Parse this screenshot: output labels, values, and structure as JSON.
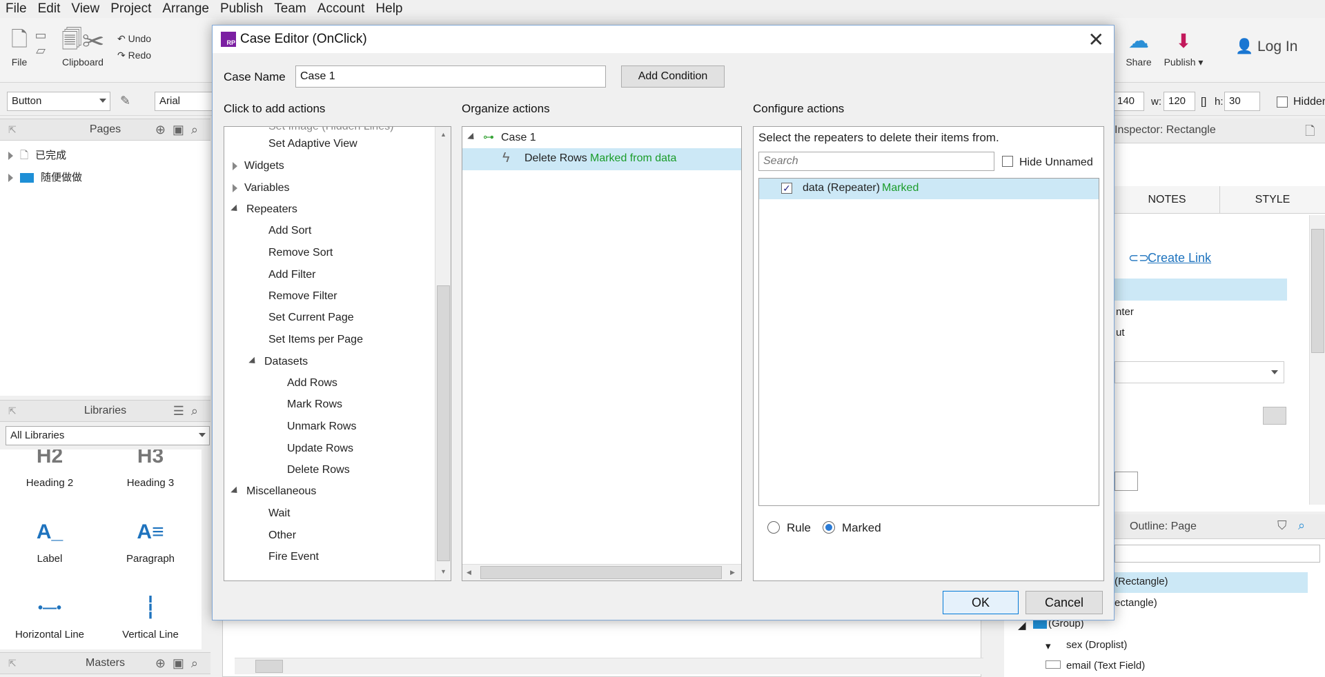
{
  "menu": [
    "File",
    "Edit",
    "View",
    "Project",
    "Arrange",
    "Publish",
    "Team",
    "Account",
    "Help"
  ],
  "toolbar": {
    "file_label": "File",
    "clipboard_label": "Clipboard",
    "undo_label": "Undo",
    "redo_label": "Redo",
    "share_label": "Share",
    "publish_label": "Publish ▾",
    "login_label": "Log In"
  },
  "format_bar": {
    "widget_type": "Button",
    "font": "Arial",
    "x_value": "140",
    "w_label": "w:",
    "w_value": "120",
    "h_label": "h:",
    "h_value": "30",
    "hidden_label": "Hidden"
  },
  "pages_panel": {
    "title": "Pages",
    "items": [
      "已完成",
      "随便做做"
    ]
  },
  "libraries_panel": {
    "title": "Libraries",
    "selected_library": "All Libraries",
    "items": [
      {
        "label": "Heading 2",
        "glyph": "H2"
      },
      {
        "label": "Heading 3",
        "glyph": "H3"
      },
      {
        "label": "Label",
        "glyph": "A_"
      },
      {
        "label": "Paragraph",
        "glyph": "A≡"
      },
      {
        "label": "Horizontal Line",
        "glyph": "•—•"
      },
      {
        "label": "Vertical Line",
        "glyph": "┆"
      }
    ]
  },
  "masters_panel": {
    "title": "Masters"
  },
  "inspector": {
    "title": "Inspector: Rectangle",
    "tab_notes": "NOTES",
    "tab_style": "STYLE",
    "create_link": "Create Link",
    "partial_1": "nter",
    "partial_2": "ut"
  },
  "outline": {
    "title": "Outline: Page",
    "items": [
      "(Rectangle)",
      "ectangle)",
      "(Group)",
      "sex (Droplist)",
      "email (Text Field)"
    ]
  },
  "dialog": {
    "title": "Case Editor (OnClick)",
    "case_name_label": "Case Name",
    "case_name_value": "Case 1",
    "add_condition_label": "Add Condition",
    "add_actions_title": "Click to add actions",
    "organize_title": "Organize actions",
    "configure_title": "Configure actions",
    "actions": [
      {
        "label": "Set Adaptive View",
        "level": 2,
        "kind": "leaf"
      },
      {
        "label": "Widgets",
        "level": 1,
        "kind": "collapsed"
      },
      {
        "label": "Variables",
        "level": 1,
        "kind": "collapsed"
      },
      {
        "label": "Repeaters",
        "level": 1,
        "kind": "expanded"
      },
      {
        "label": "Add Sort",
        "level": 2,
        "kind": "leaf"
      },
      {
        "label": "Remove Sort",
        "level": 2,
        "kind": "leaf"
      },
      {
        "label": "Add Filter",
        "level": 2,
        "kind": "leaf"
      },
      {
        "label": "Remove Filter",
        "level": 2,
        "kind": "leaf"
      },
      {
        "label": "Set Current Page",
        "level": 2,
        "kind": "leaf"
      },
      {
        "label": "Set Items per Page",
        "level": 2,
        "kind": "leaf"
      },
      {
        "label": "Datasets",
        "level": 2,
        "kind": "expanded"
      },
      {
        "label": "Add Rows",
        "level": 3,
        "kind": "leaf"
      },
      {
        "label": "Mark Rows",
        "level": 3,
        "kind": "leaf"
      },
      {
        "label": "Unmark Rows",
        "level": 3,
        "kind": "leaf"
      },
      {
        "label": "Update Rows",
        "level": 3,
        "kind": "leaf"
      },
      {
        "label": "Delete Rows",
        "level": 3,
        "kind": "leaf"
      },
      {
        "label": "Miscellaneous",
        "level": 1,
        "kind": "expanded"
      },
      {
        "label": "Wait",
        "level": 2,
        "kind": "leaf"
      },
      {
        "label": "Other",
        "level": 2,
        "kind": "leaf"
      },
      {
        "label": "Fire Event",
        "level": 2,
        "kind": "leaf"
      }
    ],
    "organize": {
      "case_label": "Case 1",
      "action_name": "Delete Rows",
      "action_detail": "Marked from data"
    },
    "configure": {
      "instruction": "Select the repeaters to delete their items from.",
      "search_placeholder": "Search",
      "hide_unnamed_label": "Hide Unnamed",
      "repeater_name": "data (Repeater)",
      "repeater_status": "Marked",
      "repeater_checked": true,
      "rule_label": "Rule",
      "marked_label": "Marked",
      "selected_mode": "Marked"
    },
    "ok_label": "OK",
    "cancel_label": "Cancel"
  }
}
